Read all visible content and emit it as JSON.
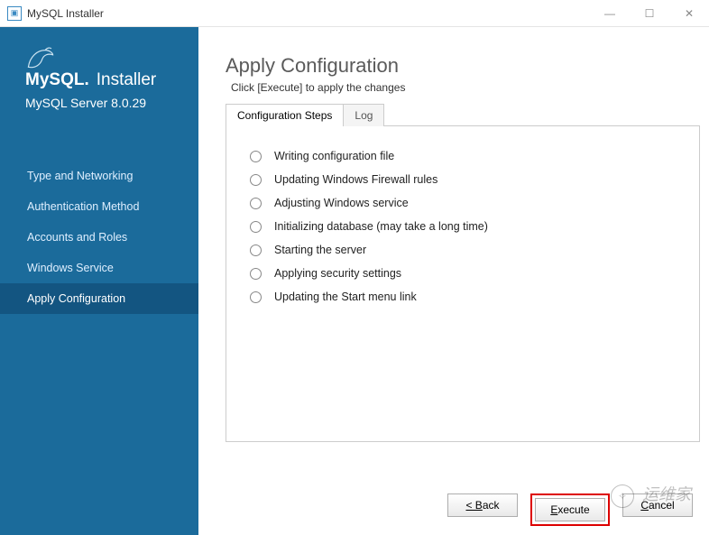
{
  "window": {
    "title": "MySQL Installer"
  },
  "sidebar": {
    "brand_mysql": "MySQL.",
    "brand_installer": "Installer",
    "subtitle": "MySQL Server 8.0.29",
    "items": [
      {
        "label": "Type and Networking",
        "active": false
      },
      {
        "label": "Authentication Method",
        "active": false
      },
      {
        "label": "Accounts and Roles",
        "active": false
      },
      {
        "label": "Windows Service",
        "active": false
      },
      {
        "label": "Apply Configuration",
        "active": true
      }
    ]
  },
  "main": {
    "title": "Apply Configuration",
    "subtitle": "Click [Execute] to apply the changes",
    "tabs": [
      {
        "label": "Configuration Steps",
        "active": true
      },
      {
        "label": "Log",
        "active": false
      }
    ],
    "steps": [
      {
        "label": "Writing configuration file"
      },
      {
        "label": "Updating Windows Firewall rules"
      },
      {
        "label": "Adjusting Windows service"
      },
      {
        "label": "Initializing database (may take a long time)"
      },
      {
        "label": "Starting the server"
      },
      {
        "label": "Applying security settings"
      },
      {
        "label": "Updating the Start menu link"
      }
    ]
  },
  "buttons": {
    "back": "< Back",
    "execute": "Execute",
    "cancel": "Cancel"
  },
  "watermark": "运维家"
}
